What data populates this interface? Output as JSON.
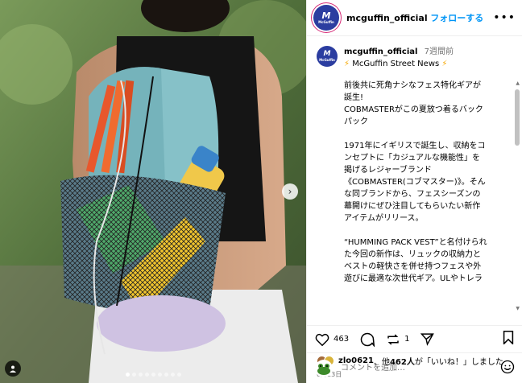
{
  "colors": {
    "accent": "#0095f6",
    "avatar_bg": "#2b3da0",
    "muted": "#737373",
    "bolt": "#f6a800"
  },
  "post": {
    "username": "mcguffin_official",
    "follow_label": "フォローする",
    "avatar_mark": "M",
    "avatar_sub": "McGuffin",
    "time_ago": "7週間前",
    "subtitle": "McGuffin Street News",
    "caption_lines": [
      "前後共に死角ナシなフェス特化ギアが",
      "誕生!",
      "COBMASTERがこの夏放つ着るバック",
      "パック",
      "",
      "1971年にイギリスで誕生し、収納をコ",
      "ンセプトに「カジュアルな機能性」を",
      "掲げるレジャーブランド",
      "《COBMASTER(コブマスター)》。そん",
      "な同ブランドから、フェスシーズンの",
      "幕開けにぜひ注目してもらいたい新作",
      "アイテムがリリース。",
      "",
      "“HUMMING PACK VEST”と名付けられ",
      "た今回の新作は、リュックの収納力と",
      "ベストの軽快さを併せ持つフェスや外",
      "遊びに最適な次世代ギア。ULやトレラ"
    ],
    "like_count": "463",
    "comment_count": "",
    "share_count": "1",
    "liked_by_user": "zlo0621",
    "liked_by_text": "、他",
    "liked_by_count": "462人",
    "liked_by_suffix": "が「いいね！」しました",
    "date": "6月23日",
    "comment_placeholder": "コメントを追加…"
  },
  "icons": {
    "more": "more-icon",
    "like": "heart-icon",
    "comment": "comment-icon",
    "share": "repost-icon",
    "send": "send-icon",
    "save": "bookmark-icon",
    "emoji": "emoji-icon",
    "next": "chevron-right-icon",
    "tag": "user-tag-icon"
  },
  "carousel": {
    "total": 9,
    "active": 0
  }
}
